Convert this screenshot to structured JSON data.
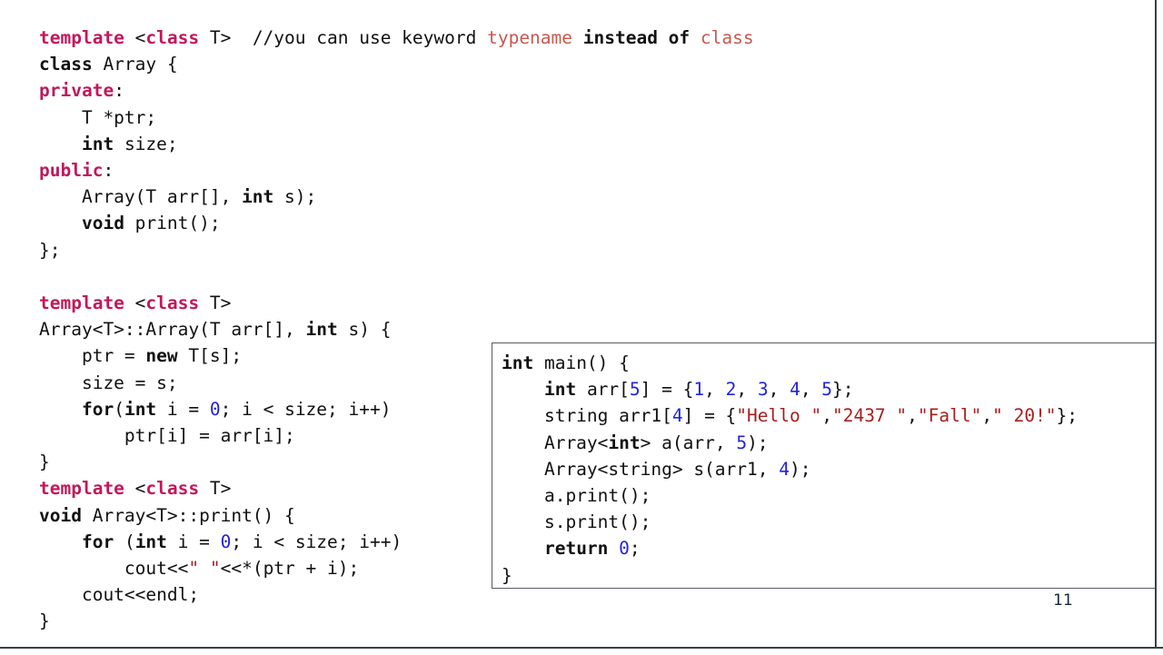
{
  "slide": {
    "page_number": "11",
    "language": "C++",
    "colors": {
      "background": "#ffffff",
      "keyword_magenta": "#C2185B",
      "keyword_black": "#111111",
      "number_blue": "#2222DD",
      "string_red": "#A81E1E",
      "comment_keyword_red": "#C8584F",
      "box_border": "#575b60",
      "slide_edge": "#3a3f45",
      "page_number_color": "#17243b"
    }
  },
  "left_code": {
    "lines": [
      [
        {
          "t": "template",
          "c": "kw-magenta"
        },
        {
          "t": " <",
          "c": "plain"
        },
        {
          "t": "class",
          "c": "kw-magenta"
        },
        {
          "t": " T>  ",
          "c": "plain"
        },
        {
          "t": "//you can use keyword ",
          "c": "cmt"
        },
        {
          "t": "typename",
          "c": "cmt-kw"
        },
        {
          "t": " ",
          "c": "cmt"
        },
        {
          "t": "instead of",
          "c": "cmt-b"
        },
        {
          "t": " ",
          "c": "cmt"
        },
        {
          "t": "class",
          "c": "cmt-kw"
        }
      ],
      [
        {
          "t": "class",
          "c": "kw-black"
        },
        {
          "t": " Array {",
          "c": "plain"
        }
      ],
      [
        {
          "t": "private",
          "c": "kw-magenta"
        },
        {
          "t": ":",
          "c": "plain"
        }
      ],
      [
        {
          "t": "    T *ptr;",
          "c": "plain"
        }
      ],
      [
        {
          "t": "    ",
          "c": "plain"
        },
        {
          "t": "int",
          "c": "kw-black"
        },
        {
          "t": " size;",
          "c": "plain"
        }
      ],
      [
        {
          "t": "public",
          "c": "kw-magenta"
        },
        {
          "t": ":",
          "c": "plain"
        }
      ],
      [
        {
          "t": "    Array(T arr[], ",
          "c": "plain"
        },
        {
          "t": "int",
          "c": "kw-black"
        },
        {
          "t": " s);",
          "c": "plain"
        }
      ],
      [
        {
          "t": "    ",
          "c": "plain"
        },
        {
          "t": "void",
          "c": "kw-black"
        },
        {
          "t": " print();",
          "c": "plain"
        }
      ],
      [
        {
          "t": "};",
          "c": "plain"
        }
      ],
      [
        {
          "t": "",
          "c": "plain"
        }
      ],
      [
        {
          "t": "template",
          "c": "kw-magenta"
        },
        {
          "t": " <",
          "c": "plain"
        },
        {
          "t": "class",
          "c": "kw-magenta"
        },
        {
          "t": " T>",
          "c": "plain"
        }
      ],
      [
        {
          "t": "Array<T>::Array(T arr[], ",
          "c": "plain"
        },
        {
          "t": "int",
          "c": "kw-black"
        },
        {
          "t": " s) {",
          "c": "plain"
        }
      ],
      [
        {
          "t": "    ptr = ",
          "c": "plain"
        },
        {
          "t": "new",
          "c": "kw-black"
        },
        {
          "t": " T[s];",
          "c": "plain"
        }
      ],
      [
        {
          "t": "    size = s;",
          "c": "plain"
        }
      ],
      [
        {
          "t": "    ",
          "c": "plain"
        },
        {
          "t": "for",
          "c": "kw-black"
        },
        {
          "t": "(",
          "c": "plain"
        },
        {
          "t": "int",
          "c": "kw-black"
        },
        {
          "t": " i = ",
          "c": "plain"
        },
        {
          "t": "0",
          "c": "num"
        },
        {
          "t": "; i < size; i++)",
          "c": "plain"
        }
      ],
      [
        {
          "t": "        ptr[i] = arr[i];",
          "c": "plain"
        }
      ],
      [
        {
          "t": "}",
          "c": "plain"
        }
      ],
      [
        {
          "t": "template",
          "c": "kw-magenta"
        },
        {
          "t": " <",
          "c": "plain"
        },
        {
          "t": "class",
          "c": "kw-magenta"
        },
        {
          "t": " T>",
          "c": "plain"
        }
      ],
      [
        {
          "t": "void",
          "c": "kw-black"
        },
        {
          "t": " Array<T>::print() {",
          "c": "plain"
        }
      ],
      [
        {
          "t": "    ",
          "c": "plain"
        },
        {
          "t": "for",
          "c": "kw-black"
        },
        {
          "t": " (",
          "c": "plain"
        },
        {
          "t": "int",
          "c": "kw-black"
        },
        {
          "t": " i = ",
          "c": "plain"
        },
        {
          "t": "0",
          "c": "num"
        },
        {
          "t": "; i < size; i++)",
          "c": "plain"
        }
      ],
      [
        {
          "t": "        cout<<",
          "c": "plain"
        },
        {
          "t": "\" \"",
          "c": "str"
        },
        {
          "t": "<<*(ptr + i);",
          "c": "plain"
        }
      ],
      [
        {
          "t": "    cout<<endl;",
          "c": "plain"
        }
      ],
      [
        {
          "t": "}",
          "c": "plain"
        }
      ]
    ]
  },
  "main_box_code": {
    "lines": [
      [
        {
          "t": "int",
          "c": "kw-black"
        },
        {
          "t": " main() {",
          "c": "plain"
        }
      ],
      [
        {
          "t": "    ",
          "c": "plain"
        },
        {
          "t": "int",
          "c": "kw-black"
        },
        {
          "t": " arr[",
          "c": "plain"
        },
        {
          "t": "5",
          "c": "num"
        },
        {
          "t": "] = {",
          "c": "plain"
        },
        {
          "t": "1",
          "c": "num"
        },
        {
          "t": ", ",
          "c": "plain"
        },
        {
          "t": "2",
          "c": "num"
        },
        {
          "t": ", ",
          "c": "plain"
        },
        {
          "t": "3",
          "c": "num"
        },
        {
          "t": ", ",
          "c": "plain"
        },
        {
          "t": "4",
          "c": "num"
        },
        {
          "t": ", ",
          "c": "plain"
        },
        {
          "t": "5",
          "c": "num"
        },
        {
          "t": "};",
          "c": "plain"
        }
      ],
      [
        {
          "t": "    string arr1[",
          "c": "plain"
        },
        {
          "t": "4",
          "c": "num"
        },
        {
          "t": "] = {",
          "c": "plain"
        },
        {
          "t": "\"Hello \"",
          "c": "str"
        },
        {
          "t": ",",
          "c": "plain"
        },
        {
          "t": "\"2437 \"",
          "c": "str"
        },
        {
          "t": ",",
          "c": "plain"
        },
        {
          "t": "\"Fall\"",
          "c": "str"
        },
        {
          "t": ",",
          "c": "plain"
        },
        {
          "t": "\" 20!\"",
          "c": "str"
        },
        {
          "t": "};",
          "c": "plain"
        }
      ],
      [
        {
          "t": "    Array<",
          "c": "plain"
        },
        {
          "t": "int",
          "c": "kw-black"
        },
        {
          "t": "> a(arr, ",
          "c": "plain"
        },
        {
          "t": "5",
          "c": "num"
        },
        {
          "t": ");",
          "c": "plain"
        }
      ],
      [
        {
          "t": "    Array<string> s(arr1, ",
          "c": "plain"
        },
        {
          "t": "4",
          "c": "num"
        },
        {
          "t": ");",
          "c": "plain"
        }
      ],
      [
        {
          "t": "    a.print();",
          "c": "plain"
        }
      ],
      [
        {
          "t": "    s.print();",
          "c": "plain"
        }
      ],
      [
        {
          "t": "    ",
          "c": "plain"
        },
        {
          "t": "return",
          "c": "kw-black"
        },
        {
          "t": " ",
          "c": "plain"
        },
        {
          "t": "0",
          "c": "num"
        },
        {
          "t": ";",
          "c": "plain"
        }
      ],
      [
        {
          "t": "}",
          "c": "plain"
        }
      ]
    ]
  }
}
